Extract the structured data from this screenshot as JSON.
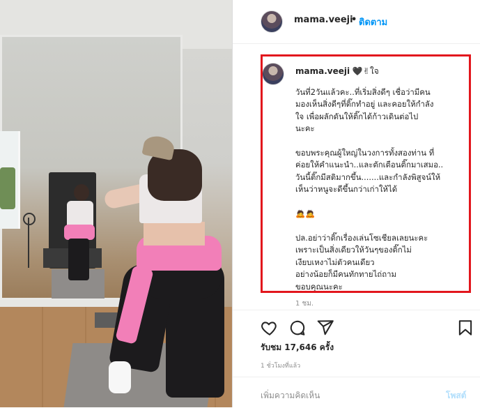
{
  "post": {
    "username": "mama.veeji",
    "separator": "•",
    "follow_label": "ติดตาม"
  },
  "caption": {
    "username": "mama.veeji",
    "suffix_emoji": "🖤✌",
    "suffix_text": "ใจ",
    "body": "วันที่2วันแล้วคะ..ที่เริ่มสิ่งดีๆ เชื่อว่ามีคน\nมองเห็นสิ่งดีๆที่ติ๊กทำอยู่ และคอยให้กำลัง\nใจ เพื่อผลักดันให้ติ๊กได้ก้าวเดินต่อไป\nนะคะ\n\nขอบพระคุณผู้ใหญ่ในวงการทั้งสองท่าน ที่\nค่อยให้คำแนะนำ..และตักเตือนติ๊กมาเสมอ..\nวันนี้ติ๊กมีสติมากขึ้น.......และกำลังพิสูจน์ให้\nเห็นว่าหนูจะดีขึ้นกว่าเก่าให้ได้\n\n🙇🙇\n\nปล.อย่าว่าติ๊กเรื่องเล่นโซเชียลเลยนะคะ\nเพราะเป็นสิ่งเดียวให้วันๆของติ๊กไม่\nเงียบเหงาไม่ตัวคนเดียว\nอย่างน้อยก็มีคนทักทายไถ่ถาม\nขอบคุณนะคะ",
    "time": "1 ชม."
  },
  "actions": {
    "like_icon": "heart-icon",
    "comment_icon": "comment-icon",
    "share_icon": "share-icon",
    "save_icon": "bookmark-icon"
  },
  "stats": {
    "views": "รับชม 17,646 ครั้ง",
    "posted": "1 ชั่วโมงที่แล้ว"
  },
  "add_comment": {
    "placeholder": "เพิ่มความคิดเห็น",
    "post_label": "โพสต์"
  },
  "colors": {
    "accent": "#0095f6",
    "highlight": "#e2161d",
    "post_disabled": "#b2dffc"
  }
}
